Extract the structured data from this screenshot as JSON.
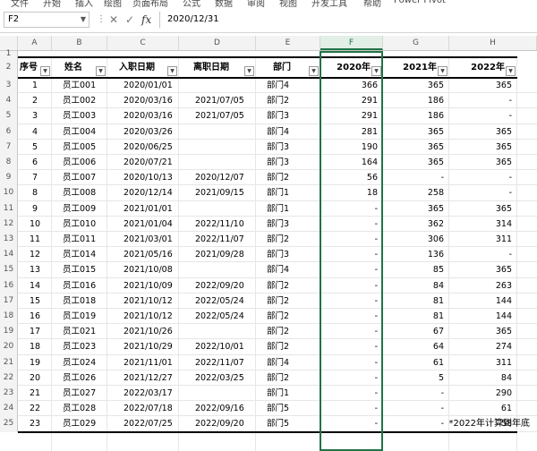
{
  "ribbon_tabs": [
    "文件",
    "开始",
    "插入",
    "绘图",
    "页面布局",
    "公式",
    "数据",
    "审阅",
    "视图",
    "开发工具",
    "帮助",
    "Power Pivot"
  ],
  "formula_bar": {
    "name_box": "F2",
    "cancel_icon": "close-icon",
    "enter_icon": "check-icon",
    "function_icon": "fx",
    "formula": "2020/12/31"
  },
  "column_letters": [
    "A",
    "B",
    "C",
    "D",
    "E",
    "F",
    "G",
    "H"
  ],
  "selected_column": "F",
  "row_numbers": [
    "1",
    "2",
    "3",
    "4",
    "5",
    "6",
    "7",
    "8",
    "9",
    "10",
    "11",
    "12",
    "13",
    "14",
    "15",
    "16",
    "17",
    "18",
    "19",
    "20",
    "21",
    "22",
    "23",
    "24",
    "25"
  ],
  "table": {
    "headers": [
      "序号",
      "姓名",
      "入职日期",
      "离职日期",
      "部门",
      "2020年",
      "2021年",
      "2022年"
    ],
    "rows": [
      [
        "1",
        "员工001",
        "2020/01/01",
        "",
        "部门4",
        "366",
        "365",
        "365"
      ],
      [
        "2",
        "员工002",
        "2020/03/16",
        "2021/07/05",
        "部门2",
        "291",
        "186",
        "-"
      ],
      [
        "3",
        "员工003",
        "2020/03/16",
        "2021/07/05",
        "部门3",
        "291",
        "186",
        "-"
      ],
      [
        "4",
        "员工004",
        "2020/03/26",
        "",
        "部门4",
        "281",
        "365",
        "365"
      ],
      [
        "5",
        "员工005",
        "2020/06/25",
        "",
        "部门3",
        "190",
        "365",
        "365"
      ],
      [
        "6",
        "员工006",
        "2020/07/21",
        "",
        "部门3",
        "164",
        "365",
        "365"
      ],
      [
        "7",
        "员工007",
        "2020/10/13",
        "2020/12/07",
        "部门2",
        "56",
        "-",
        "-"
      ],
      [
        "8",
        "员工008",
        "2020/12/14",
        "2021/09/15",
        "部门1",
        "18",
        "258",
        "-"
      ],
      [
        "9",
        "员工009",
        "2021/01/01",
        "",
        "部门1",
        "-",
        "365",
        "365"
      ],
      [
        "10",
        "员工010",
        "2021/01/04",
        "2022/11/10",
        "部门3",
        "-",
        "362",
        "314"
      ],
      [
        "11",
        "员工011",
        "2021/03/01",
        "2022/11/07",
        "部门2",
        "-",
        "306",
        "311"
      ],
      [
        "12",
        "员工014",
        "2021/05/16",
        "2021/09/28",
        "部门3",
        "-",
        "136",
        "-"
      ],
      [
        "13",
        "员工015",
        "2021/10/08",
        "",
        "部门4",
        "-",
        "85",
        "365"
      ],
      [
        "14",
        "员工016",
        "2021/10/09",
        "2022/09/20",
        "部门2",
        "-",
        "84",
        "263"
      ],
      [
        "15",
        "员工018",
        "2021/10/12",
        "2022/05/24",
        "部门2",
        "-",
        "81",
        "144"
      ],
      [
        "16",
        "员工019",
        "2021/10/12",
        "2022/05/24",
        "部门2",
        "-",
        "81",
        "144"
      ],
      [
        "17",
        "员工021",
        "2021/10/26",
        "",
        "部门2",
        "-",
        "67",
        "365"
      ],
      [
        "18",
        "员工023",
        "2021/10/29",
        "2022/10/01",
        "部门2",
        "-",
        "64",
        "274"
      ],
      [
        "19",
        "员工024",
        "2021/11/01",
        "2022/11/07",
        "部门4",
        "-",
        "61",
        "311"
      ],
      [
        "20",
        "员工026",
        "2021/12/27",
        "2022/03/25",
        "部门2",
        "-",
        "5",
        "84"
      ],
      [
        "21",
        "员工027",
        "2022/03/17",
        "",
        "部门1",
        "-",
        "-",
        "290"
      ],
      [
        "22",
        "员工028",
        "2022/07/18",
        "2022/09/16",
        "部门5",
        "-",
        "-",
        "61"
      ],
      [
        "23",
        "员工029",
        "2022/07/25",
        "2022/09/20",
        "部门5",
        "-",
        "-",
        "58"
      ]
    ]
  },
  "footnote": "*2022年计算到年底",
  "colors": {
    "accent": "#217346",
    "header_bg": "#f3f3f3",
    "grid": "#e6e6e6"
  }
}
